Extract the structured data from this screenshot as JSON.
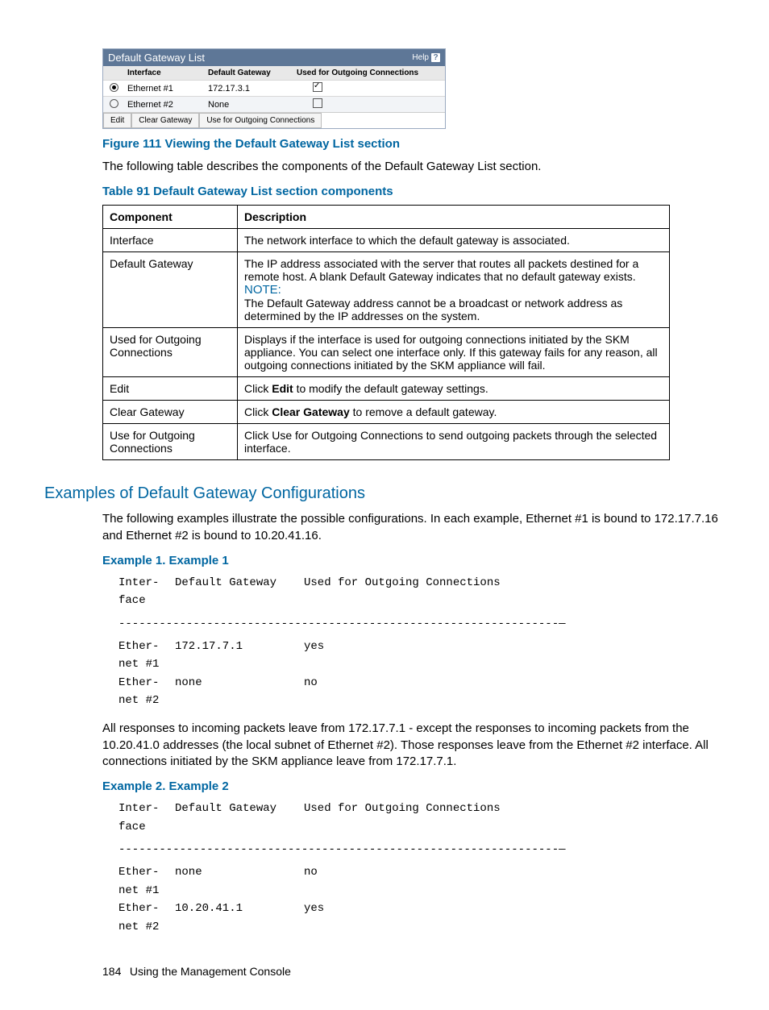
{
  "panel": {
    "title": "Default Gateway List",
    "help_label": "Help",
    "columns": {
      "c1": "Interface",
      "c2": "Default Gateway",
      "c3": "Used for Outgoing Connections"
    },
    "rows": [
      {
        "iface": "Ethernet #1",
        "gw": "172.17.3.1",
        "selected": true,
        "outgoing": true
      },
      {
        "iface": "Ethernet #2",
        "gw": "None",
        "selected": false,
        "outgoing": false
      }
    ],
    "buttons": {
      "edit": "Edit",
      "clear": "Clear Gateway",
      "use": "Use for Outgoing Connections"
    }
  },
  "figure_caption": "Figure 111 Viewing the Default Gateway List section",
  "intro_text": "The following table describes the components of the Default Gateway List section.",
  "table_caption": "Table 91 Default Gateway List section components",
  "table": {
    "head": {
      "c1": "Component",
      "c2": "Description"
    },
    "rows": {
      "r0": {
        "comp": "Interface",
        "desc": "The network interface to which the default gateway is associated."
      },
      "r1": {
        "comp": "Default Gateway",
        "desc_pre": "The IP address associated with the server that routes all packets destined for a remote host. A blank Default Gateway indicates that no default gateway exists.",
        "note_label": "NOTE:",
        "desc_post": "The Default Gateway address cannot be a broadcast or network address as determined by the IP addresses on the system."
      },
      "r2": {
        "comp": "Used for Outgoing Connections",
        "desc": "Displays if the interface is used for outgoing connections initiated by the SKM appliance. You can select one interface only. If this gateway fails for any reason, all outgoing connections initiated by the SKM appliance will fail."
      },
      "r3": {
        "comp": "Edit",
        "desc_pre": "Click ",
        "bold": "Edit",
        "desc_post": " to modify the default gateway settings."
      },
      "r4": {
        "comp": "Clear Gateway",
        "desc_pre": "Click ",
        "bold": "Clear Gateway",
        "desc_post": " to remove a default gateway."
      },
      "r5": {
        "comp": "Use for Outgoing Connections",
        "desc": "Click Use for Outgoing Connections to send outgoing packets through the selected interface."
      }
    }
  },
  "section_heading": "Examples of Default Gateway Configurations",
  "section_intro": "The following examples illustrate the possible configurations. In each example, Ethernet #1 is bound to 172.17.7.16 and Ethernet #2 is bound to 10.20.41.16.",
  "example1": {
    "title": "Example 1. Example 1",
    "head": {
      "c1a": "Inter-",
      "c1b": "face",
      "c2": "Default Gateway",
      "c3": "Used for Outgoing Connections"
    },
    "rows": {
      "r0": {
        "ifacea": "Ether-",
        "ifaceb": "net #1",
        "gw": "172.17.7.1",
        "out": "yes"
      },
      "r1": {
        "ifacea": "Ether-",
        "ifaceb": "net #2",
        "gw": "none",
        "out": "no"
      }
    },
    "para": "All responses to incoming packets leave from 172.17.7.1 - except the responses to incoming packets from the 10.20.41.0 addresses (the local subnet of Ethernet #2). Those responses leave from the Ethernet #2 interface. All connections initiated by the SKM appliance leave from 172.17.7.1."
  },
  "example2": {
    "title": "Example 2. Example 2",
    "head": {
      "c1a": "Inter-",
      "c1b": "face",
      "c2": "Default Gateway",
      "c3": "Used for Outgoing Connections"
    },
    "rows": {
      "r0": {
        "ifacea": "Ether-",
        "ifaceb": "net #1",
        "gw": "none",
        "out": "no"
      },
      "r1": {
        "ifacea": "Ether-",
        "ifaceb": "net #2",
        "gw": "10.20.41.1",
        "out": "yes"
      }
    }
  },
  "footer": {
    "page": "184",
    "title": "Using the Management Console"
  },
  "divider": "-----------------------------------------------------------------—"
}
